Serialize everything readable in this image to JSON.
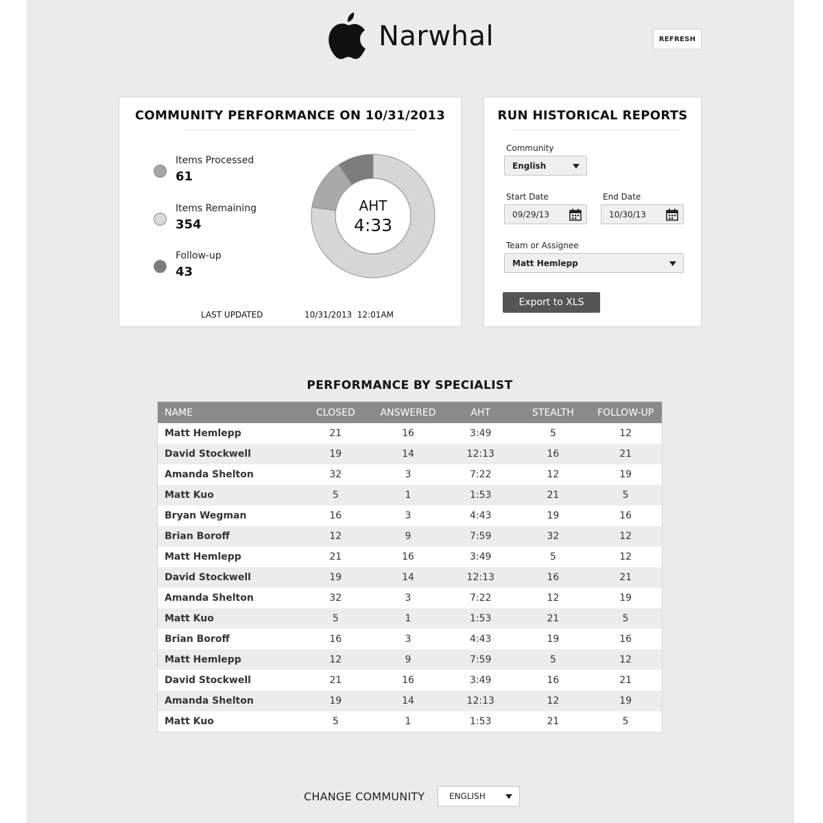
{
  "app": {
    "title": "Narwhal",
    "refresh_label": "REFRESH"
  },
  "performance": {
    "title": "COMMUNITY PERFORMANCE ON 10/31/2013",
    "stats": [
      {
        "label": "Items Processed",
        "value": "61",
        "color": "#a6a6a6"
      },
      {
        "label": "Items Remaining",
        "value": "354",
        "color": "#d9d9d9"
      },
      {
        "label": "Follow-up",
        "value": "43",
        "color": "#7c7c7c"
      }
    ],
    "aht_label": "AHT",
    "aht_value": "4:33",
    "last_updated_label": "LAST UPDATED",
    "last_updated_value": "10/31/2013  12:01AM",
    "chart_data": {
      "type": "pie",
      "categories": [
        "Items Remaining",
        "Items Processed",
        "Follow-up"
      ],
      "values": [
        354,
        61,
        43
      ],
      "colors": [
        "#d6d6d6",
        "#a9a9a9",
        "#7d7d7d"
      ]
    }
  },
  "historical": {
    "title": "RUN HISTORICAL REPORTS",
    "community_label": "Community",
    "community_value": "English",
    "start_label": "Start Date",
    "start_value": "09/29/13",
    "end_label": "End Date",
    "end_value": "10/30/13",
    "team_label": "Team or Assignee",
    "team_value": "Matt Hemlepp",
    "export_label": "Export to XLS"
  },
  "specialists": {
    "title": "PERFORMANCE BY SPECIALIST",
    "headers": [
      "NAME",
      "CLOSED",
      "ANSWERED",
      "AHT",
      "STEALTH",
      "FOLLOW-UP"
    ],
    "rows": [
      [
        "Matt Hemlepp",
        "21",
        "16",
        "3:49",
        "5",
        "12"
      ],
      [
        "David Stockwell",
        "19",
        "14",
        "12:13",
        "16",
        "21"
      ],
      [
        "Amanda Shelton",
        "32",
        "3",
        "7:22",
        "12",
        "19"
      ],
      [
        "Matt Kuo",
        "5",
        "1",
        "1:53",
        "21",
        "5"
      ],
      [
        "Bryan Wegman",
        "16",
        "3",
        "4:43",
        "19",
        "16"
      ],
      [
        "Brian Boroff",
        "12",
        "9",
        "7:59",
        "32",
        "12"
      ],
      [
        "Matt Hemlepp",
        "21",
        "16",
        "3:49",
        "5",
        "12"
      ],
      [
        "David Stockwell",
        "19",
        "14",
        "12:13",
        "16",
        "21"
      ],
      [
        "Amanda Shelton",
        "32",
        "3",
        "7:22",
        "12",
        "19"
      ],
      [
        "Matt Kuo",
        "5",
        "1",
        "1:53",
        "21",
        "5"
      ],
      [
        "Brian Boroff",
        "16",
        "3",
        "4:43",
        "19",
        "16"
      ],
      [
        "Matt Hemlepp",
        "12",
        "9",
        "7:59",
        "5",
        "12"
      ],
      [
        "David Stockwell",
        "21",
        "16",
        "3:49",
        "16",
        "21"
      ],
      [
        "Amanda Shelton",
        "19",
        "14",
        "12:13",
        "12",
        "19"
      ],
      [
        "Matt Kuo",
        "5",
        "1",
        "1:53",
        "21",
        "5"
      ]
    ]
  },
  "footer": {
    "change_label": "CHANGE COMMUNITY",
    "community_value": "ENGLISH"
  }
}
